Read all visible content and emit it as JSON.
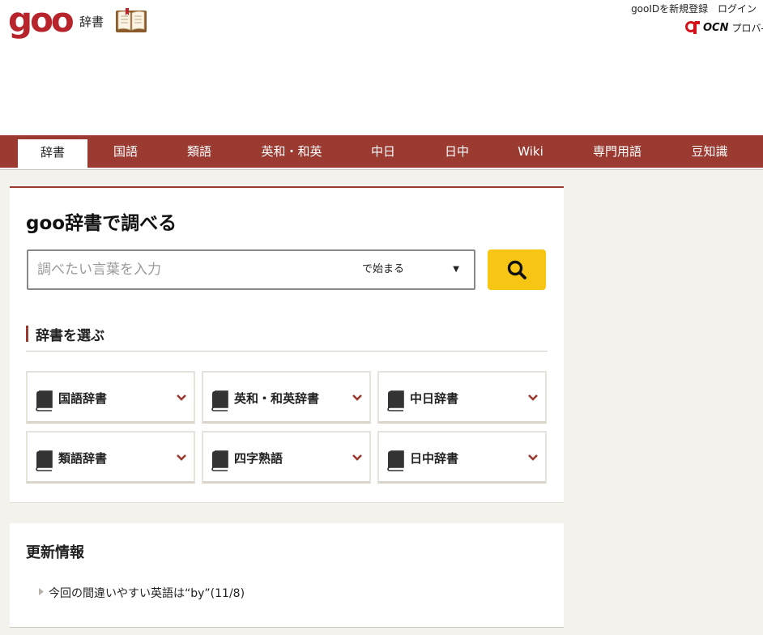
{
  "header": {
    "logo_text": "goo",
    "service_name": "辞書",
    "links": [
      "gooIDを新規登録",
      "ログイン"
    ],
    "ocn_label": "OCN",
    "ocn_provider_text": "プロバ-"
  },
  "nav": {
    "tabs": [
      {
        "label": "辞書",
        "active": true
      },
      {
        "label": "国語"
      },
      {
        "label": "類語"
      },
      {
        "label": "英和・和英"
      },
      {
        "label": "中日"
      },
      {
        "label": "日中"
      },
      {
        "label": "Wiki"
      },
      {
        "label": "専門用語"
      },
      {
        "label": "豆知識"
      }
    ]
  },
  "search": {
    "title": "goo辞書で調べる",
    "placeholder": "調べたい言葉を入力",
    "value": "",
    "match_mode": "で始まる"
  },
  "dictionaries": {
    "heading": "辞書を選ぶ",
    "items": [
      {
        "label": "国語辞書"
      },
      {
        "label": "英和・和英辞書"
      },
      {
        "label": "中日辞書"
      },
      {
        "label": "類語辞書"
      },
      {
        "label": "四字熟語"
      },
      {
        "label": "日中辞書"
      }
    ]
  },
  "updates": {
    "heading": "更新情報",
    "items": [
      {
        "text": "今回の間違いやすい英語は“by”(11/8)"
      }
    ]
  },
  "colors": {
    "brand_red": "#b8242c",
    "nav_bg": "#9a3a30",
    "search_button": "#f7c615",
    "page_bg": "#f4f2ec"
  }
}
